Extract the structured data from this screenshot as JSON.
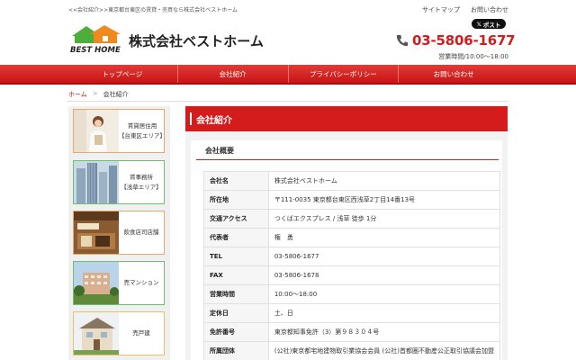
{
  "header": {
    "tagline": "<<会社紹介>>東京都台東区の賃貸・売買なら株式会社ベストホーム",
    "links": [
      "サイトマップ",
      "お問い合わせ"
    ],
    "x_post_label": "ポスト",
    "logo_text": "BEST HOME",
    "company_name": "株式会社ベストホーム",
    "phone": "03-5806-1677",
    "hours": "営業時間/10:00～18:00"
  },
  "nav": {
    "items": [
      "トップページ",
      "会社紹介",
      "プライバシーポリシー",
      "お問い合わせ"
    ]
  },
  "breadcrumb": {
    "home": "ホーム",
    "separator": ">",
    "current": "会社紹介"
  },
  "sidebar": {
    "cards": [
      {
        "line1": "賃貸居住用",
        "line2": "【台東区エリア】",
        "image": "woman-photo"
      },
      {
        "line1": "賃事務所",
        "line2": "【浅草エリア】",
        "image": "office-buildings-photo"
      },
      {
        "line1": "飲食店司店舗",
        "line2": "",
        "image": "restaurant-photo"
      },
      {
        "line1": "売マンション",
        "line2": "",
        "image": "apartment-photo"
      },
      {
        "line1": "売戸建",
        "line2": "",
        "image": "house-photo"
      }
    ]
  },
  "main": {
    "heading": "会社紹介",
    "section_title": "会社概要",
    "table": [
      {
        "key": "会社名",
        "value": "株式会社ベストホーム"
      },
      {
        "key": "所在地",
        "value": "〒111-0035 東京都台東区西浅草2丁目14番13号"
      },
      {
        "key": "交通アクセス",
        "value": "つくばエクスプレス / 浅草 徒歩 1分"
      },
      {
        "key": "代表者",
        "value": "権　勇"
      },
      {
        "key": "TEL",
        "value": "03-5806-1677"
      },
      {
        "key": "FAX",
        "value": "03-5806-1678"
      },
      {
        "key": "営業時間",
        "value": "10:00～18:00"
      },
      {
        "key": "定休日",
        "value": "土、日"
      },
      {
        "key": "免許番号",
        "value": "東京都知事免許（3）第９８３０４号"
      },
      {
        "key": "所属団体",
        "value": "(公社)東京都宅地建物取引業協会会員 (公社)首都圏不動産公正取引協議会加盟"
      }
    ]
  },
  "colors": {
    "brand_red": "#d41c1c",
    "logo_green": "#4caf3a",
    "logo_orange": "#f08a1e"
  }
}
